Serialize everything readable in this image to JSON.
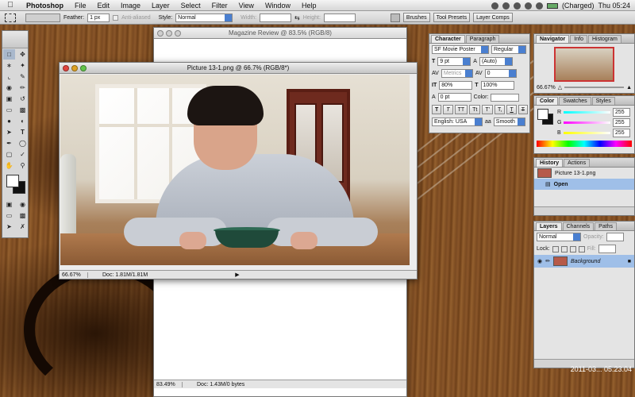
{
  "menubar": {
    "app": "Photoshop",
    "menus": [
      "File",
      "Edit",
      "Image",
      "Layer",
      "Select",
      "Filter",
      "View",
      "Window",
      "Help"
    ],
    "battery": "(Charged)",
    "clock": "Thu 05:24"
  },
  "options": {
    "feather_label": "Feather:",
    "feather_value": "1 px",
    "antialiased": "Anti-aliased",
    "style_label": "Style:",
    "style_value": "Normal",
    "width_label": "Width:",
    "height_label": "Height:",
    "workspace_tabs": [
      "Brushes",
      "Tool Presets",
      "Layer Comps"
    ]
  },
  "windows": {
    "magazine": {
      "title": "Magazine Review @ 83.5% (RGB/8)",
      "zoom": "83.49%",
      "doc": "Doc: 1.43M/0 bytes"
    },
    "picture": {
      "title": "Picture 13-1.png @ 66.7% (RGB/8*)",
      "zoom": "66.67%",
      "doc": "Doc: 1.81M/1.81M"
    }
  },
  "character": {
    "tabs": [
      "Character",
      "Paragraph"
    ],
    "font": "SF Movie Poster",
    "style": "Regular",
    "size": "9 pt",
    "leading": "(Auto)",
    "kerning": "Metrics",
    "tracking": "0",
    "vscale": "80%",
    "hscale": "100%",
    "baseline": "0 pt",
    "color_label": "Color:",
    "language": "English: USA",
    "aa_label": "aa",
    "antialias": "Smooth",
    "format_buttons": [
      "T",
      "T",
      "TT",
      "Tt",
      "T'",
      "T,",
      "T",
      "T"
    ]
  },
  "navigator": {
    "tabs": [
      "Navigator",
      "Info",
      "Histogram"
    ],
    "zoom": "66.67%"
  },
  "color": {
    "tabs": [
      "Color",
      "Swatches",
      "Styles"
    ],
    "channels": [
      {
        "label": "R",
        "value": "255"
      },
      {
        "label": "G",
        "value": "255"
      },
      {
        "label": "B",
        "value": "255"
      }
    ]
  },
  "history": {
    "tabs": [
      "History",
      "Actions"
    ],
    "snapshot": "Picture 13-1.png",
    "steps": [
      "Open"
    ]
  },
  "layers": {
    "tabs": [
      "Layers",
      "Channels",
      "Paths"
    ],
    "blend": "Normal",
    "opacity_label": "Opacity:",
    "fill_label": "Fill:",
    "lock_label": "Lock:",
    "layer_name": "Background"
  },
  "desktop": {
    "timestamp": "2011-03... 05.23.04"
  },
  "colors": {
    "accent": "#4a7fd0",
    "selection": "#9fbfe8"
  }
}
